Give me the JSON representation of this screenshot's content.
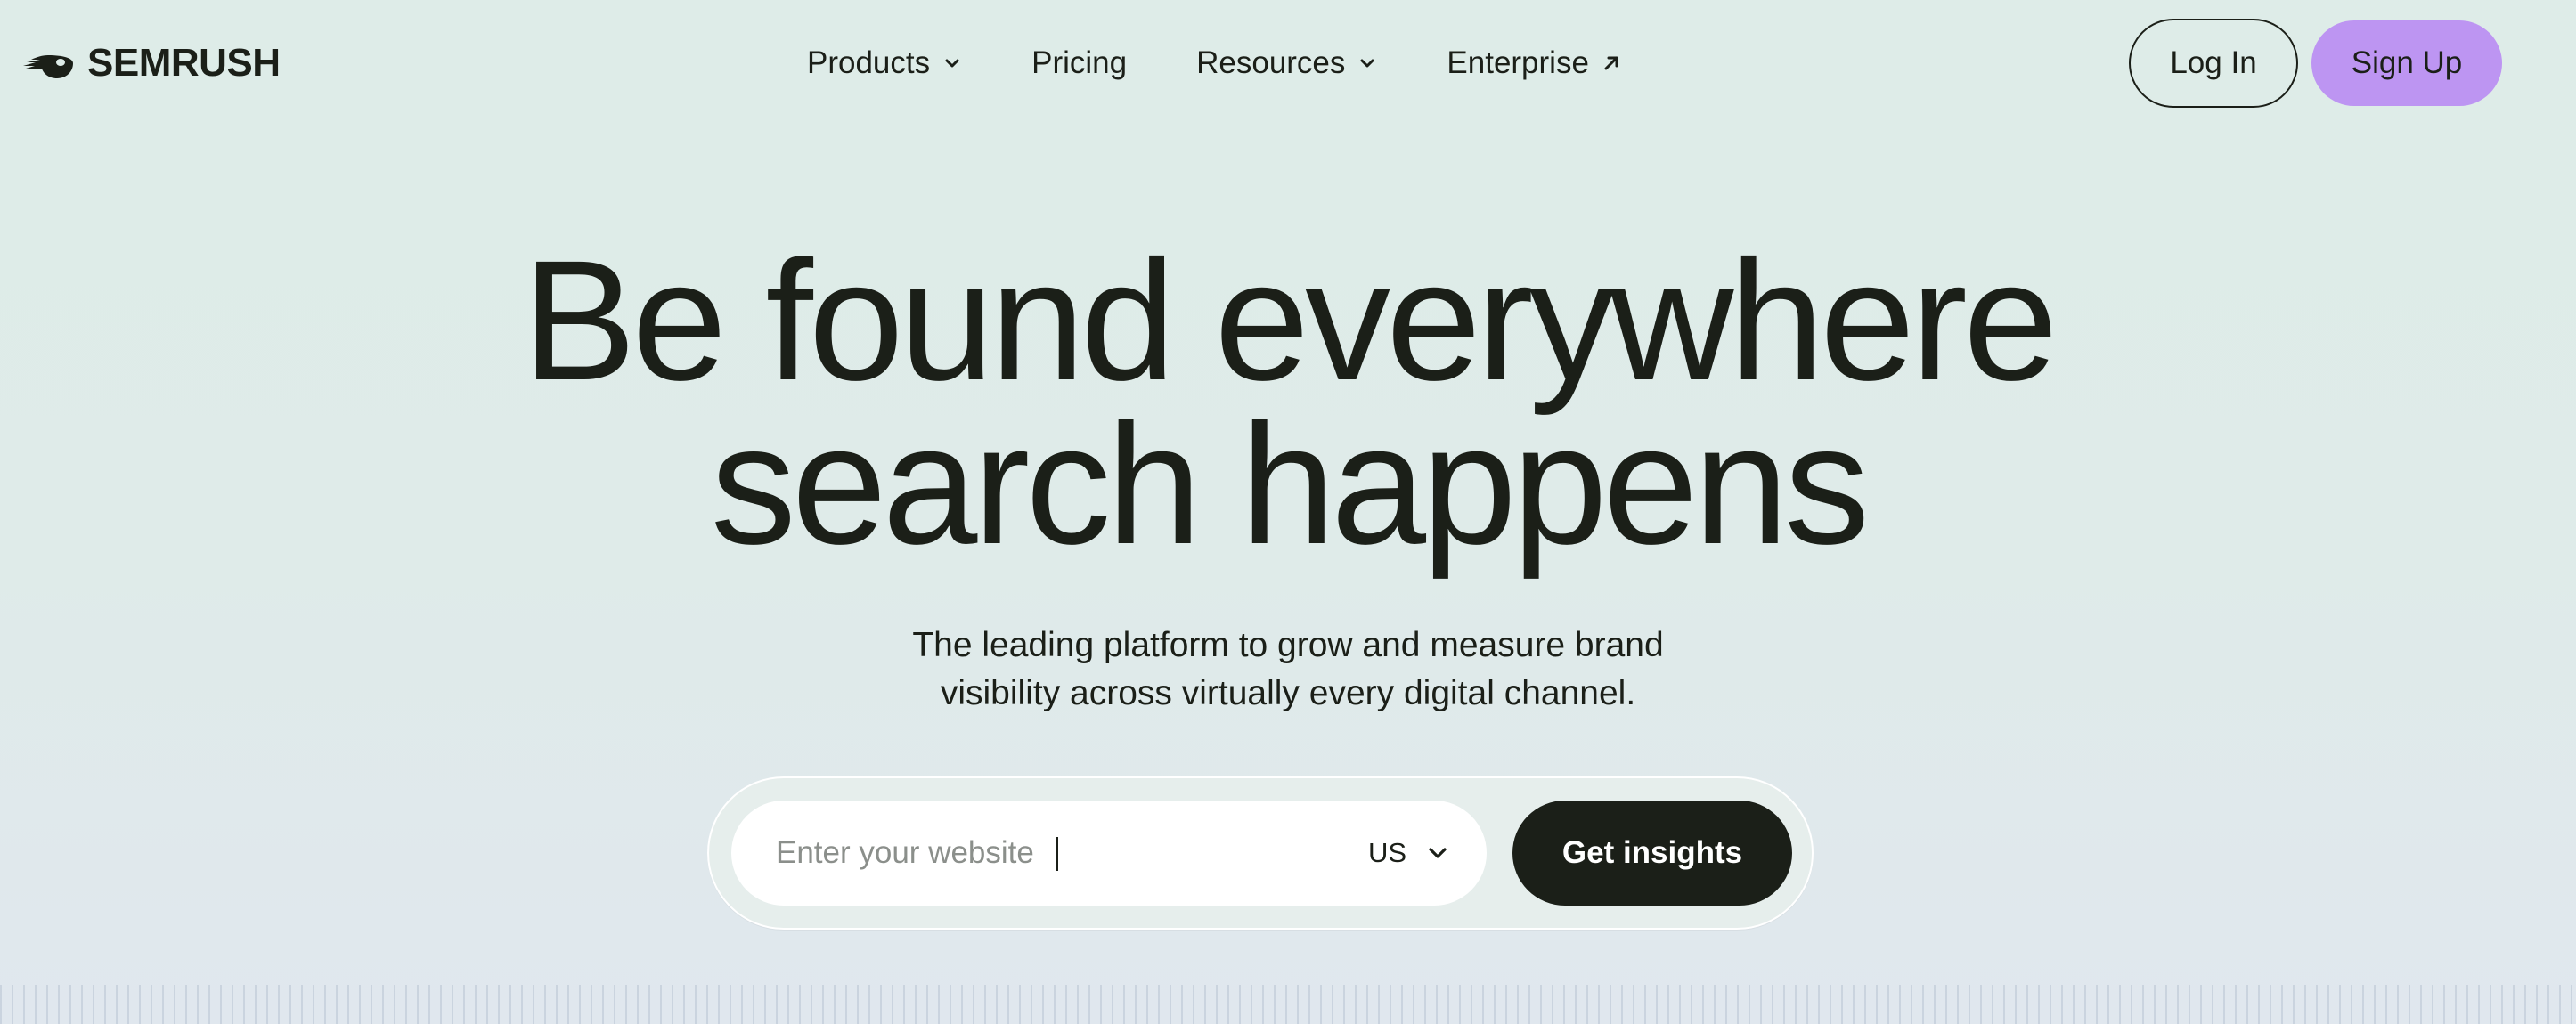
{
  "header": {
    "logo_text": "SEMRUSH",
    "logo_icon": "semrush-fireball-icon",
    "nav": [
      {
        "label": "Products",
        "icon": "chevron-down-icon"
      },
      {
        "label": "Pricing",
        "icon": ""
      },
      {
        "label": "Resources",
        "icon": "chevron-down-icon"
      },
      {
        "label": "Enterprise",
        "icon": "arrow-up-right-icon"
      }
    ],
    "login_label": "Log In",
    "signup_label": "Sign Up"
  },
  "hero": {
    "title_line1": "Be found everywhere",
    "title_line2": "search happens",
    "subtitle_line1": "The leading platform to grow and measure brand",
    "subtitle_line2": "visibility across virtually every digital channel."
  },
  "search": {
    "placeholder": "Enter your website",
    "value": "",
    "country": "US",
    "country_icon": "chevron-down-icon",
    "submit_label": "Get insights"
  },
  "colors": {
    "background": "#deece8",
    "text": "#1b1f18",
    "signup_accent": "#bd95f2",
    "primary_button": "#1b1f18"
  }
}
